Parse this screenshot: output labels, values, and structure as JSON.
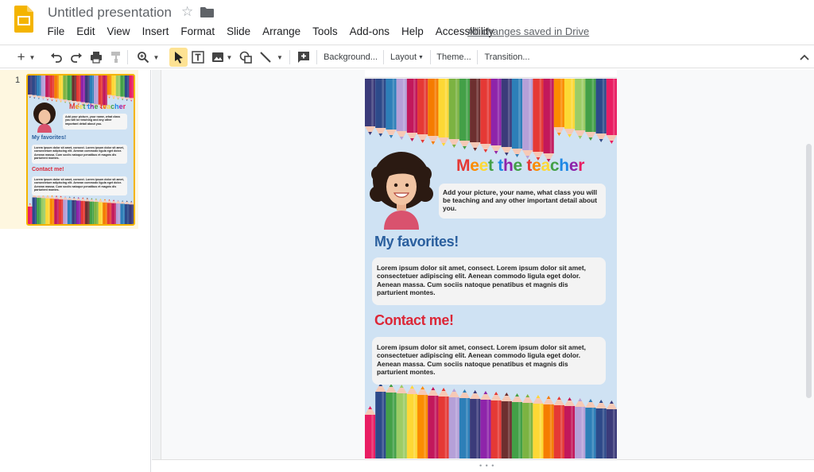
{
  "app": {
    "title": "Untitled presentation",
    "saved_status": "All changes saved in Drive"
  },
  "menu": [
    "File",
    "Edit",
    "View",
    "Insert",
    "Format",
    "Slide",
    "Arrange",
    "Tools",
    "Add-ons",
    "Help",
    "Accessibility"
  ],
  "toolbar": {
    "background_label": "Background...",
    "layout_label": "Layout",
    "theme_label": "Theme...",
    "transition_label": "Transition...",
    "icons": [
      "new-slide-icon",
      "undo-icon",
      "redo-icon",
      "print-icon",
      "paint-format-icon",
      "zoom-icon",
      "select-icon",
      "text-box-icon",
      "image-icon",
      "shape-icon",
      "line-icon",
      "comment-icon",
      "collapse-icon"
    ]
  },
  "filmstrip": {
    "slide_number": "1"
  },
  "slide": {
    "title_letters": [
      {
        "ch": "M",
        "color": "#e53935"
      },
      {
        "ch": "e",
        "color": "#fb8c00"
      },
      {
        "ch": "e",
        "color": "#fdd835"
      },
      {
        "ch": "t",
        "color": "#43a047"
      },
      {
        "ch": " ",
        "color": "#000000"
      },
      {
        "ch": "t",
        "color": "#1e88e5"
      },
      {
        "ch": "h",
        "color": "#8e24aa"
      },
      {
        "ch": "e",
        "color": "#43a047"
      },
      {
        "ch": " ",
        "color": "#000000"
      },
      {
        "ch": "t",
        "color": "#e53935"
      },
      {
        "ch": "e",
        "color": "#fb8c00"
      },
      {
        "ch": "a",
        "color": "#fdd835"
      },
      {
        "ch": "c",
        "color": "#43a047"
      },
      {
        "ch": "h",
        "color": "#1e88e5"
      },
      {
        "ch": "e",
        "color": "#8e24aa"
      },
      {
        "ch": "r",
        "color": "#e91e63"
      }
    ],
    "intro": "Add your picture, your name, what class you will be teaching and any other important detail about you.",
    "favorites_heading": "My favorites!",
    "favorites_body": "Lorem ipsum dolor sit amet, consect. Lorem ipsum dolor sit amet, consectetuer adipiscing elit. Aenean commodo ligula eget dolor. Aenean massa. Cum sociis natoque penatibus et magnis dis parturient montes.",
    "contact_heading": "Contact me!",
    "contact_body": "Lorem ipsum dolor sit amet, consect. Lorem ipsum dolor sit amet, consectetuer adipiscing elit. Aenean commodo ligula eget dolor. Aenean massa. Cum sociis natoque penatibus et magnis dis parturient montes.",
    "pencil_colors": [
      "#3b3b7a",
      "#2d4a8a",
      "#2d7fb8",
      "#b5a0d8",
      "#c2185b",
      "#e53935",
      "#f57c00",
      "#fdd835",
      "#7cb342",
      "#43a047",
      "#6d2f2f",
      "#e53935",
      "#8e24aa",
      "#3b3b7a",
      "#2d7fb8",
      "#b5a0d8",
      "#e53935",
      "#c2185b",
      "#fb8c00",
      "#fdd835",
      "#9ccc65",
      "#43a047",
      "#2d4a8a",
      "#e91e63"
    ]
  },
  "colors": {
    "accent": "#f4b400",
    "slide_bg": "#cfe2f3",
    "favorites": "#2a5f9e",
    "contact": "#dc2737"
  }
}
